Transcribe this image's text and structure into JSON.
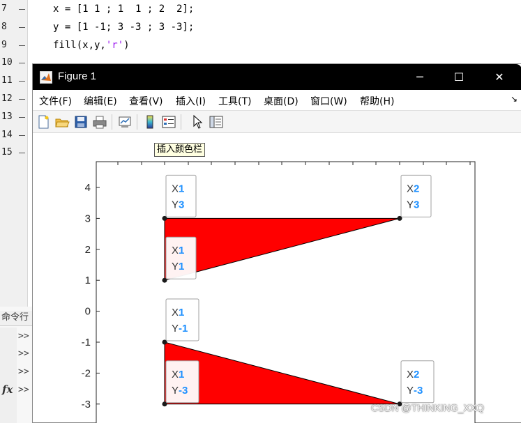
{
  "editor": {
    "lines": [
      {
        "num": "7",
        "code_pre": "x = [1 1 ; 1  1 ; 2  2];",
        "code_str": "",
        "code_post": ""
      },
      {
        "num": "8",
        "code_pre": "y = [1 -1; 3 -3 ; 3 -3];",
        "code_str": "",
        "code_post": ""
      },
      {
        "num": "9",
        "code_pre": "fill(x,y,",
        "code_str": "'r'",
        "code_post": ")"
      },
      {
        "num": "10",
        "code_pre": "",
        "code_str": "",
        "code_post": ""
      },
      {
        "num": "11",
        "code_pre": "",
        "code_str": "",
        "code_post": ""
      },
      {
        "num": "12",
        "code_pre": "",
        "code_str": "",
        "code_post": ""
      },
      {
        "num": "13",
        "code_pre": "",
        "code_str": "",
        "code_post": ""
      },
      {
        "num": "14",
        "code_pre": "",
        "code_str": "",
        "code_post": ""
      },
      {
        "num": "15",
        "code_pre": "",
        "code_str": "",
        "code_post": ""
      }
    ]
  },
  "command_window": {
    "title": "命令行",
    "prompt": ">>",
    "fx": "fx"
  },
  "figure": {
    "title": "Figure 1",
    "window_buttons": {
      "minimize": "─",
      "maximize": "☐",
      "close": "✕"
    },
    "menu": [
      "文件(F)",
      "编辑(E)",
      "查看(V)",
      "插入(I)",
      "工具(T)",
      "桌面(D)",
      "窗口(W)",
      "帮助(H)"
    ],
    "menu_overflow": "↘",
    "toolbar_icons": [
      "new-figure-icon",
      "open-file-icon",
      "save-icon",
      "print-icon",
      "link-plot-icon",
      "insert-colorbar-icon",
      "insert-legend-icon",
      "edit-plot-arrow-icon",
      "property-inspector-icon"
    ],
    "tooltip": "插入颜色栏"
  },
  "chart_data": {
    "type": "area",
    "fill_color": "#ff0000",
    "polygons": [
      {
        "x": [
          1,
          1,
          2
        ],
        "y": [
          1,
          3,
          3
        ]
      },
      {
        "x": [
          1,
          1,
          2
        ],
        "y": [
          -1,
          -3,
          -3
        ]
      }
    ],
    "ylim": [
      -3.2,
      4.7
    ],
    "xlim": [
      0,
      2.3
    ],
    "yticks": [
      "4",
      "3",
      "2",
      "1",
      "0",
      "-1",
      "-2",
      "-3"
    ],
    "ytick_values": [
      4,
      3,
      2,
      1,
      0,
      -1,
      -2,
      -3
    ],
    "datatips": [
      {
        "x": "1",
        "y": "3",
        "px": 1,
        "py": 3
      },
      {
        "x": "2",
        "y": "3",
        "px": 2,
        "py": 3
      },
      {
        "x": "1",
        "y": "1",
        "px": 1,
        "py": 1
      },
      {
        "x": "1",
        "y": "-1",
        "px": 1,
        "py": -1
      },
      {
        "x": "1",
        "y": "-3",
        "px": 1,
        "py": -3
      },
      {
        "x": "2",
        "y": "-3",
        "px": 2,
        "py": -3
      }
    ],
    "datatip_x_label": "X",
    "datatip_y_label": "Y"
  },
  "watermark": "CSDN @THINKING_XXQ"
}
